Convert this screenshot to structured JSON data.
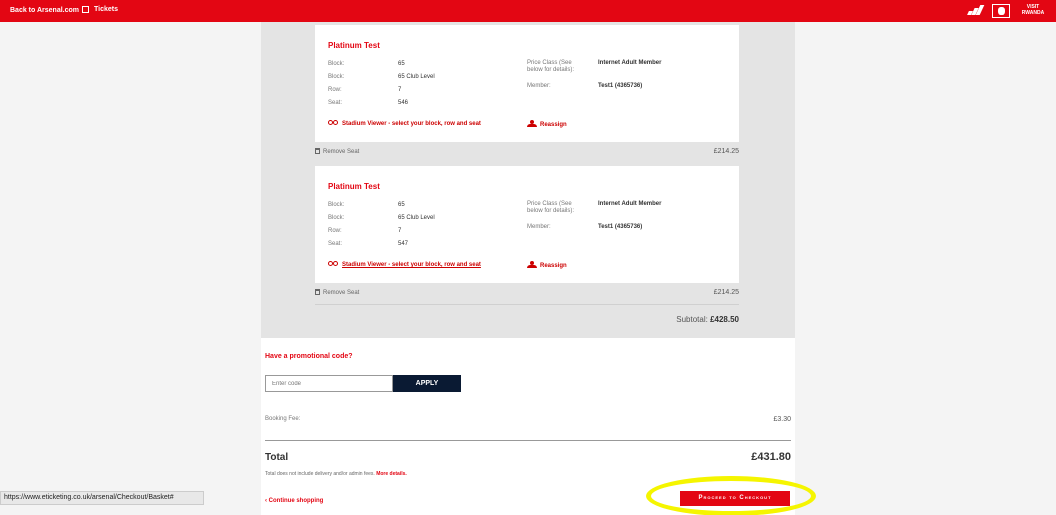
{
  "topbar": {
    "back_link": "Back to Arsenal.com",
    "tickets_link": "Tickets",
    "sponsor_rwanda": [
      "VISIT",
      "RWANDA"
    ]
  },
  "tickets": [
    {
      "title": "Platinum Test",
      "rows": [
        {
          "label": "Block:",
          "value": "65"
        },
        {
          "label": "Block:",
          "value": "65 Club Level"
        },
        {
          "label": "Row:",
          "value": "7"
        },
        {
          "label": "Seat:",
          "value": "546"
        }
      ],
      "price_class_label": "Price Class (See below for details):",
      "price_class_value": "Internet Adult Member",
      "member_label": "Member:",
      "member_value": "Test1 (4365736)",
      "viewer_link": "Stadium Viewer - select your block, row and seat",
      "reassign_link": "Reassign",
      "remove_label": "Remove Seat",
      "price": "£214.25"
    },
    {
      "title": "Platinum Test",
      "rows": [
        {
          "label": "Block:",
          "value": "65"
        },
        {
          "label": "Block:",
          "value": "65 Club Level"
        },
        {
          "label": "Row:",
          "value": "7"
        },
        {
          "label": "Seat:",
          "value": "547"
        }
      ],
      "price_class_label": "Price Class (See below for details):",
      "price_class_value": "Internet Adult Member",
      "member_label": "Member:",
      "member_value": "Test1 (4365736)",
      "viewer_link": "Stadium Viewer - select your block, row and seat",
      "reassign_link": "Reassign",
      "remove_label": "Remove Seat",
      "price": "£214.25"
    }
  ],
  "subtotal": {
    "label": "Subtotal:",
    "value": "£428.50"
  },
  "promo": {
    "title": "Have a promotional code?",
    "placeholder": "Enter code",
    "apply_label": "APPLY"
  },
  "booking_fee": {
    "label": "Booking Fee:",
    "value": "£3.30"
  },
  "total": {
    "label": "Total",
    "value": "£431.80",
    "note": "Total does not include delivery and/or admin fees.",
    "more_details": "More details."
  },
  "continue_link": "‹ Continue shopping",
  "checkout_button": "Proceed to Checkout",
  "status_url": "https://www.eticketing.co.uk/arsenal/Checkout/Basket#",
  "colors": {
    "brand_red": "#e30613",
    "apply_navy": "#0a1a33",
    "highlight": "#f5f500"
  }
}
